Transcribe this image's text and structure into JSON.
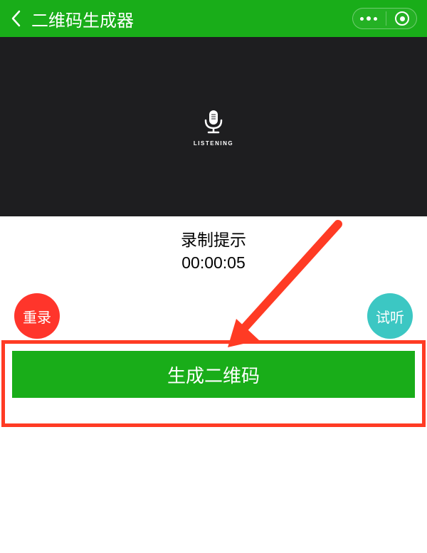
{
  "header": {
    "title": "二维码生成器"
  },
  "recording": {
    "listening_label": "LISTENING"
  },
  "info": {
    "hint_label": "录制提示",
    "timer": "00:00:05"
  },
  "controls": {
    "rerecord_label": "重录",
    "preview_label": "试听"
  },
  "main_action": {
    "generate_label": "生成二维码"
  }
}
